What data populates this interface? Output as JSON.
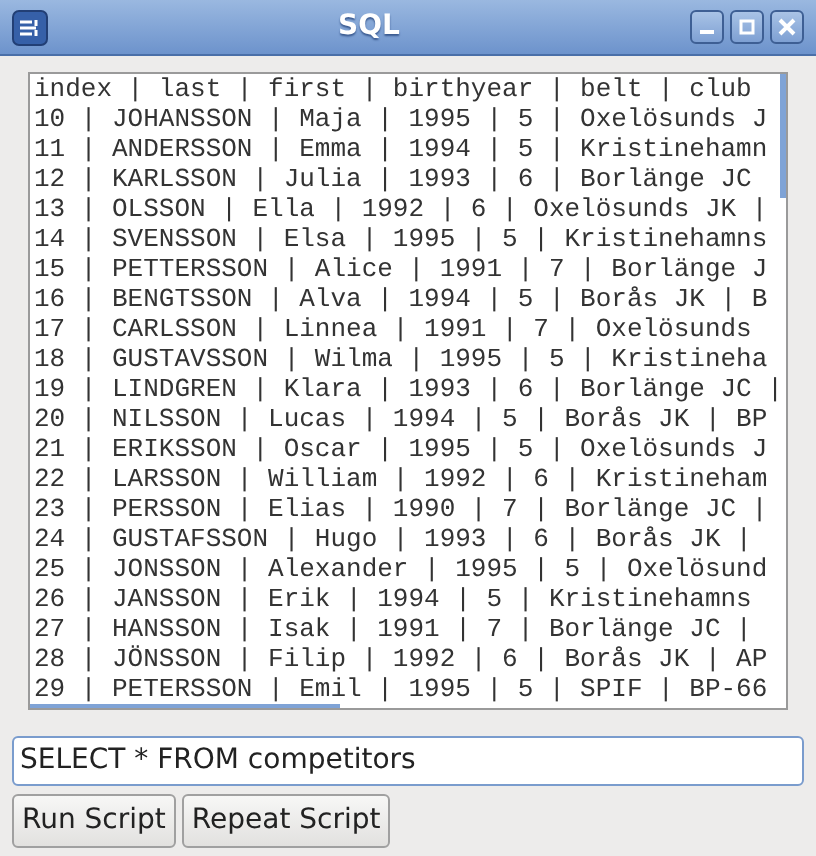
{
  "window": {
    "title": "SQL"
  },
  "output": {
    "lines": [
      "index | last | first | birthyear | belt | club",
      "10 | JOHANSSON | Maja | 1995 | 5 | Oxelösunds J",
      "11 | ANDERSSON | Emma | 1994 | 5 | Kristinehamn",
      "12 | KARLSSON | Julia | 1993 | 6 | Borlänge JC",
      "13 | OLSSON | Ella | 1992 | 6 | Oxelösunds JK |",
      "14 | SVENSSON | Elsa | 1995 | 5 | Kristinehamns",
      "15 | PETTERSSON | Alice | 1991 | 7 | Borlänge J",
      "16 | BENGTSSON | Alva | 1994 | 5 | Borås JK | B",
      "17 | CARLSSON | Linnea | 1991 | 7 | Oxelösunds",
      "18 | GUSTAVSSON | Wilma | 1995 | 5 | Kristineha",
      "19 | LINDGREN | Klara | 1993 | 6 | Borlänge JC |",
      "20 | NILSSON | Lucas | 1994 | 5 | Borås JK | BP",
      "21 | ERIKSSON | Oscar | 1995 | 5 | Oxelösunds J",
      "22 | LARSSON | William | 1992 | 6 | Kristineham",
      "23 | PERSSON | Elias | 1990 | 7 | Borlänge JC |",
      "24 | GUSTAFSSON | Hugo | 1993 | 6 | Borås JK |",
      "25 | JONSSON | Alexander | 1995 | 5 | Oxelösund",
      "26 | JANSSON | Erik | 1994 | 5 | Kristinehamns",
      "27 | HANSSON | Isak | 1991 | 7 | Borlänge JC |",
      "28 | JÖNSSON | Filip | 1992 | 6 | Borås JK | AP",
      "29 | PETERSSON | Emil | 1995 | 5 | SPIF | BP-66"
    ]
  },
  "query": {
    "value": "SELECT * FROM competitors"
  },
  "buttons": [
    "Run Script",
    "Repeat Script"
  ]
}
